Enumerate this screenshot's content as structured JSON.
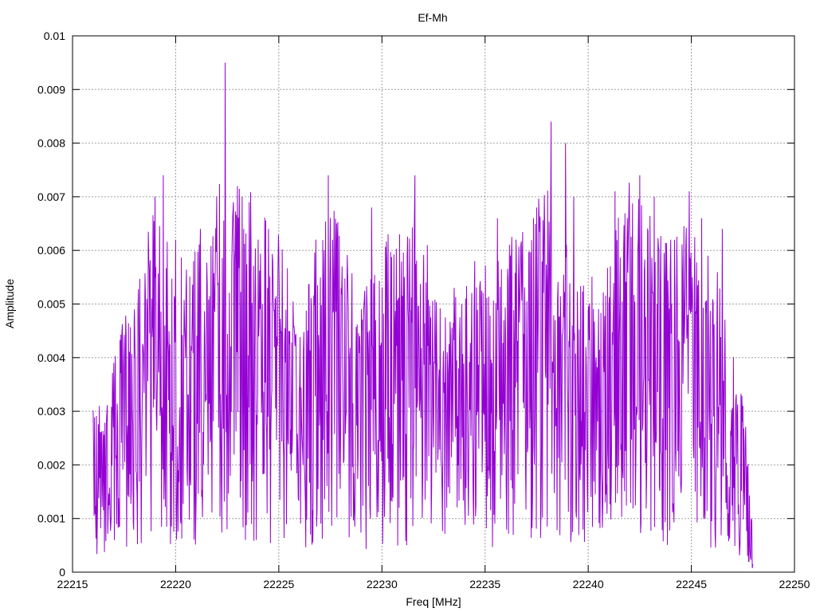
{
  "chart_data": {
    "type": "line",
    "title": "Ef-Mh",
    "xlabel": "Freq [MHz]",
    "ylabel": "Amplitude",
    "xlim": [
      22215,
      22250
    ],
    "ylim": [
      0,
      0.01
    ],
    "xticks": [
      22215,
      22220,
      22225,
      22230,
      22235,
      22240,
      22245,
      22250
    ],
    "xtick_labels": [
      "22215",
      "22220",
      "22225",
      "22230",
      "22235",
      "22240",
      "22245",
      "22250"
    ],
    "yticks": [
      0,
      0.001,
      0.002,
      0.003,
      0.004,
      0.005,
      0.006,
      0.007,
      0.008,
      0.009,
      0.01
    ],
    "ytick_labels": [
      "0",
      "0.001",
      "0.002",
      "0.003",
      "0.004",
      "0.005",
      "0.006",
      "0.007",
      "0.008",
      "0.009",
      "0.01"
    ],
    "grid": true,
    "legend": "none",
    "series": [
      {
        "color": "#9400d3",
        "x_start": 22216.0,
        "x_end": 22248.0,
        "peaks": [
          {
            "x": 22216.3,
            "y": 0.0031
          },
          {
            "x": 22217.0,
            "y": 0.0039
          },
          {
            "x": 22218.0,
            "y": 0.0049
          },
          {
            "x": 22218.7,
            "y": 0.0058
          },
          {
            "x": 22219.0,
            "y": 0.007
          },
          {
            "x": 22219.4,
            "y": 0.0074
          },
          {
            "x": 22220.0,
            "y": 0.0062
          },
          {
            "x": 22221.2,
            "y": 0.0064
          },
          {
            "x": 22222.4,
            "y": 0.0095
          },
          {
            "x": 22222.8,
            "y": 0.0069
          },
          {
            "x": 22223.3,
            "y": 0.0064
          },
          {
            "x": 22224.0,
            "y": 0.0062
          },
          {
            "x": 22224.5,
            "y": 0.0064
          },
          {
            "x": 22225.0,
            "y": 0.006
          },
          {
            "x": 22226.8,
            "y": 0.0062
          },
          {
            "x": 22227.4,
            "y": 0.0074
          },
          {
            "x": 22227.8,
            "y": 0.0065
          },
          {
            "x": 22229.5,
            "y": 0.0068
          },
          {
            "x": 22230.3,
            "y": 0.0063
          },
          {
            "x": 22231.6,
            "y": 0.0074
          },
          {
            "x": 22232.2,
            "y": 0.0061
          },
          {
            "x": 22233.5,
            "y": 0.0053
          },
          {
            "x": 22234.5,
            "y": 0.0058
          },
          {
            "x": 22235.6,
            "y": 0.0066
          },
          {
            "x": 22236.5,
            "y": 0.0062
          },
          {
            "x": 22237.5,
            "y": 0.0068
          },
          {
            "x": 22238.2,
            "y": 0.0084
          },
          {
            "x": 22238.9,
            "y": 0.008
          },
          {
            "x": 22239.3,
            "y": 0.007
          },
          {
            "x": 22241.3,
            "y": 0.0071
          },
          {
            "x": 22242.5,
            "y": 0.0074
          },
          {
            "x": 22243.2,
            "y": 0.007
          },
          {
            "x": 22244.0,
            "y": 0.0062
          },
          {
            "x": 22244.9,
            "y": 0.0071
          },
          {
            "x": 22245.5,
            "y": 0.0066
          },
          {
            "x": 22246.5,
            "y": 0.0064
          },
          {
            "x": 22247.5,
            "y": 0.0031
          },
          {
            "x": 22247.9,
            "y": 0.001
          }
        ],
        "envelope": [
          {
            "x": 22216.0,
            "y": 0.002
          },
          {
            "x": 22217.0,
            "y": 0.0026
          },
          {
            "x": 22218.0,
            "y": 0.0036
          },
          {
            "x": 22219.0,
            "y": 0.0045
          },
          {
            "x": 22220.0,
            "y": 0.0038
          },
          {
            "x": 22221.0,
            "y": 0.004
          },
          {
            "x": 22222.5,
            "y": 0.0052
          },
          {
            "x": 22224.0,
            "y": 0.0044
          },
          {
            "x": 22225.0,
            "y": 0.0041
          },
          {
            "x": 22226.0,
            "y": 0.0033
          },
          {
            "x": 22227.5,
            "y": 0.0045
          },
          {
            "x": 22229.0,
            "y": 0.0034
          },
          {
            "x": 22230.0,
            "y": 0.004
          },
          {
            "x": 22231.5,
            "y": 0.0042
          },
          {
            "x": 22233.0,
            "y": 0.0032
          },
          {
            "x": 22234.5,
            "y": 0.0036
          },
          {
            "x": 22236.0,
            "y": 0.004
          },
          {
            "x": 22238.0,
            "y": 0.0048
          },
          {
            "x": 22239.5,
            "y": 0.0037
          },
          {
            "x": 22240.5,
            "y": 0.0035
          },
          {
            "x": 22242.0,
            "y": 0.0047
          },
          {
            "x": 22243.5,
            "y": 0.0041
          },
          {
            "x": 22245.0,
            "y": 0.0042
          },
          {
            "x": 22246.5,
            "y": 0.0036
          },
          {
            "x": 22247.5,
            "y": 0.0023
          },
          {
            "x": 22248.0,
            "y": 0.0004
          }
        ]
      }
    ]
  }
}
